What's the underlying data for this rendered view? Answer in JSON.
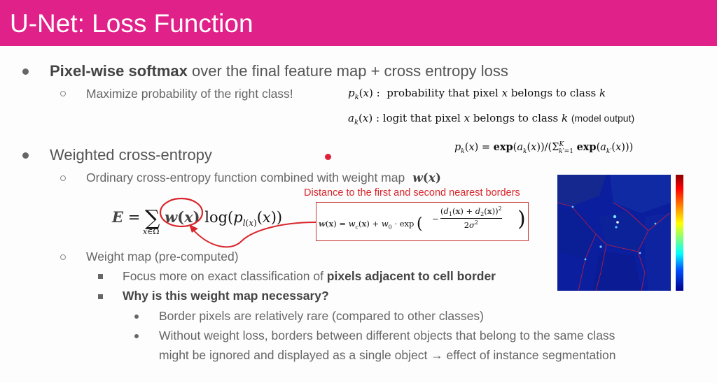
{
  "title": "U-Net: Loss Function",
  "bullet1": {
    "bold": "Pixel-wise softmax",
    "rest": " over the final feature map + cross entropy loss",
    "sub": "Maximize probability of the right class!"
  },
  "defs": {
    "pk_lhs": "p",
    "pk_text": "probability that pixel",
    "pk_text2": "belongs to class",
    "ak_text": "logit that pixel",
    "ak_text2": "belongs to class",
    "ak_note": "(model output)"
  },
  "bullet2": {
    "text": "Weighted cross-entropy",
    "sub1": "Ordinary cross-entropy function combined with weight map",
    "sub2": "Weight map (pre-computed)",
    "item1_pre": "Focus more on exact classification of ",
    "item1_bold": "pixels adjacent to cell border",
    "item2_bold": "Why is this weight map necessary?",
    "detail1": "Border pixels are relatively rare (compared to other classes)",
    "detail2_line1": "Without weight loss, borders between different objects that belong to the same class",
    "detail2_line2": "might be ignored and displayed as a single object → effect of instance segmentation"
  },
  "caption": "Distance to the first and second nearest borders",
  "colors": {
    "title_bar": "#e0218a",
    "accent_red": "#d9262c",
    "heatmap_bg": "#0b1f9e"
  }
}
